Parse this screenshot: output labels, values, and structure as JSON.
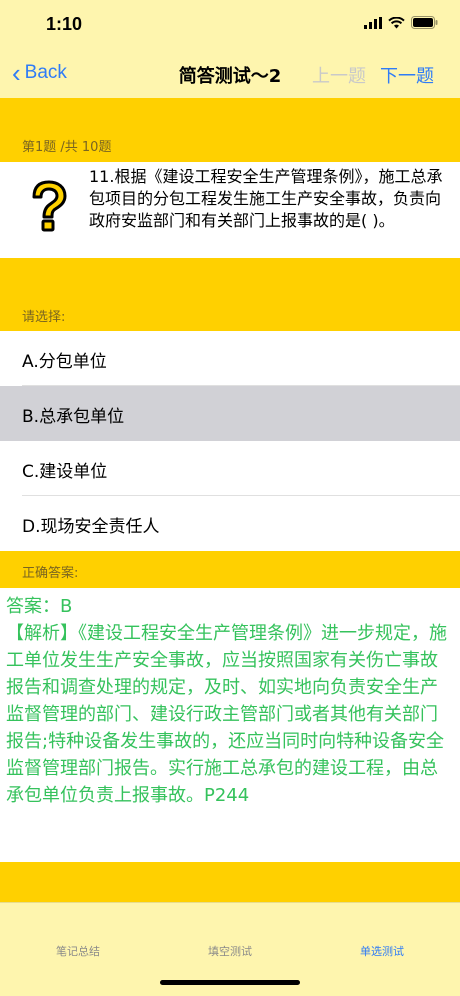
{
  "status": {
    "time": "1:10"
  },
  "nav": {
    "back_label": "Back",
    "title": "简答测试～2",
    "prev_label": "上一题",
    "next_label": "下一题"
  },
  "question": {
    "progress": "第1题 /共 10题",
    "text": "11.根据《建设工程安全生产管理条例》，施工总承包项目的分包工程发生施工生产安全事故，负责向政府安监部门和有关部门上报事故的是( )。",
    "icon": "question-mark-icon"
  },
  "options_header": "请选择:",
  "options": [
    {
      "label": "A.分包单位",
      "selected": false
    },
    {
      "label": "B.总承包单位",
      "selected": true
    },
    {
      "label": "C.建设单位",
      "selected": false
    },
    {
      "label": "D.现场安全责任人",
      "selected": false
    }
  ],
  "answer": {
    "header": "正确答案:",
    "answer_line": "答案：B",
    "analysis": "【解析】《建设工程安全生产管理条例》进一步规定，施工单位发生生产安全事故，应当按照国家有关伤亡事故报告和调查处理的规定，及时、如实地向负责安全生产监督管理的部门、建设行政主管部门或者其他有关部门报告;特种设备发生事故的，还应当同时向特种设备安全监督管理部门报告。实行施工总承包的建设工程，由总承包单位负责上报事故。P244"
  },
  "tabs": [
    {
      "label": "笔记总结",
      "active": false
    },
    {
      "label": "填空测试",
      "active": false
    },
    {
      "label": "单选测试",
      "active": true
    }
  ],
  "colors": {
    "background": "#FEF5AE",
    "band": "#FFD000",
    "accent": "#2F7CF6",
    "answer_text": "#35C25C",
    "selected_row": "#D1D1D6"
  }
}
